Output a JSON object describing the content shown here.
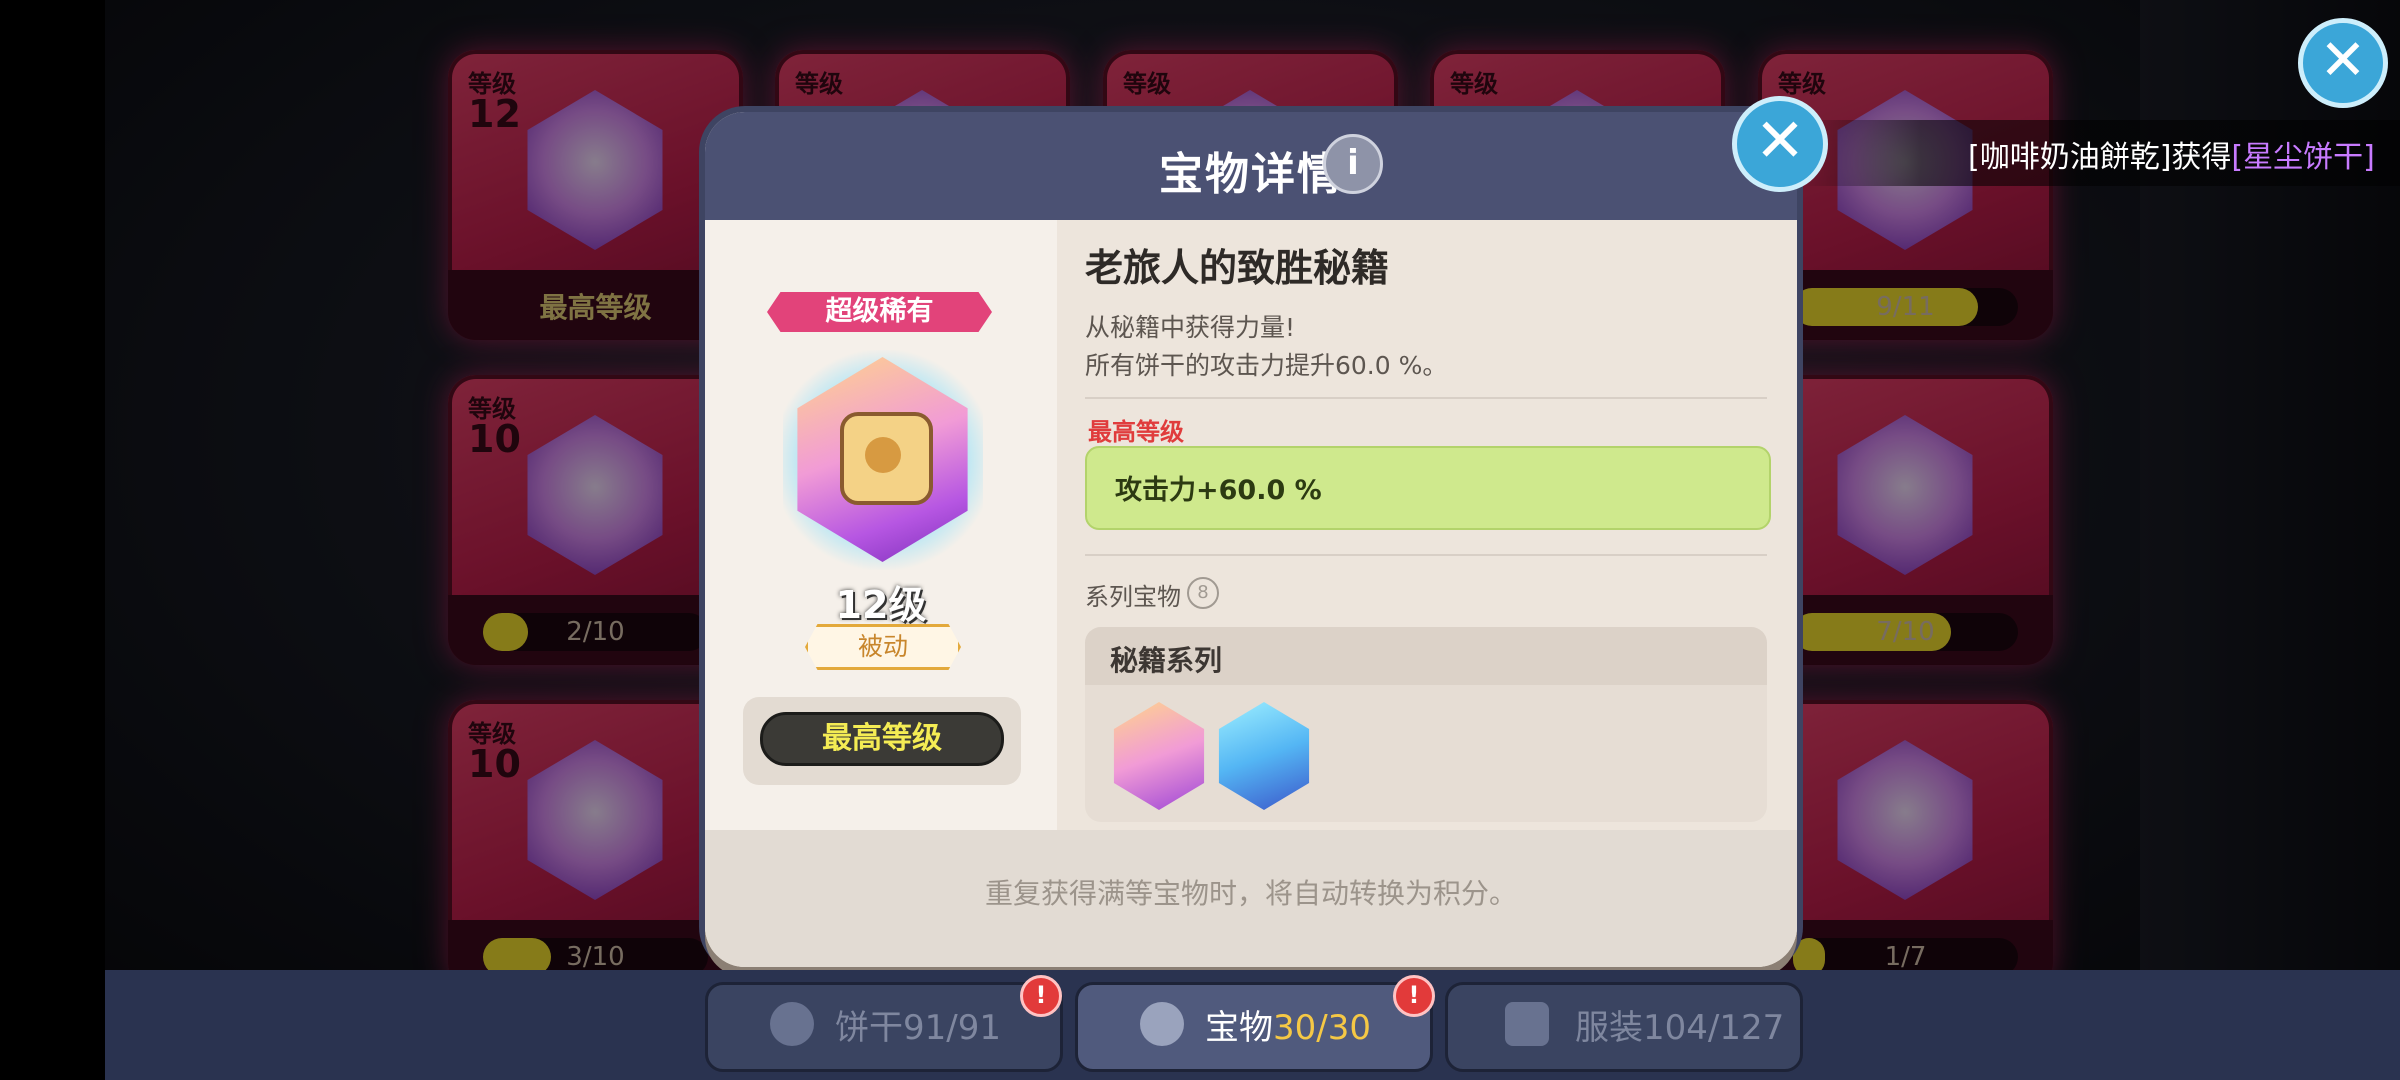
{
  "background_cards": {
    "level_label": "等级",
    "cards": [
      {
        "level": "12",
        "footer": "最高等级"
      },
      {
        "level": "10",
        "progress_text": "2/10",
        "progress": 0.2
      },
      {
        "level": "10",
        "progress_text": "3/10",
        "progress": 0.3
      },
      {
        "progress_text": "9/11",
        "progress": 0.82
      },
      {
        "progress_text": "7/10",
        "progress": 0.7
      },
      {
        "progress_text": "1/7",
        "progress": 0.14
      }
    ]
  },
  "modal": {
    "title": "宝物详情",
    "rarity": "超级稀有",
    "level": "12级",
    "type": "被动",
    "max_level_button": "最高等级",
    "treasure_name": "老旅人的致胜秘籍",
    "description_line1": "从秘籍中获得力量!",
    "description_line2": "所有饼干的攻击力提升60.0 %。",
    "max_level_label": "最高等级",
    "stat": "攻击力+60.0 %",
    "series_label": "系列宝物",
    "series_count": "8",
    "series_name": "秘籍系列",
    "bottom_note": "重复获得满等宝物时，将自动转换为积分。"
  },
  "notification": {
    "prefix": "[咖啡奶油餅乾]获得",
    "highlight": "[星尘饼干]"
  },
  "tabs": [
    {
      "label": "饼干",
      "count": "91/91",
      "badge": "!"
    },
    {
      "label": "宝物",
      "count": "30/30",
      "badge": "!"
    },
    {
      "label": "服装",
      "count": "104/127"
    }
  ],
  "close_symbol": "✕",
  "colors": {
    "accent_pink": "#e2437a",
    "accent_blue": "#3ba6d8",
    "stat_green": "#cfe98d",
    "tab_highlight": "#f5c845"
  }
}
